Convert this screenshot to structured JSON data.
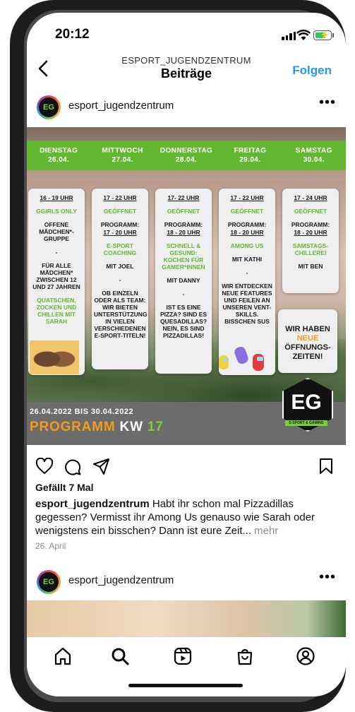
{
  "status_bar": {
    "time": "20:12"
  },
  "nav": {
    "account": "ESPORT_JUGENDZENTRUM",
    "title": "Beiträge",
    "follow_label": "Folgen"
  },
  "post": {
    "username": "esport_jugendzentrum",
    "avatar_text": "EG",
    "image": {
      "days": [
        {
          "name": "DIENSTAG",
          "date": "26.04."
        },
        {
          "name": "MITTWOCH",
          "date": "27.04."
        },
        {
          "name": "DONNERSTAG",
          "date": "28.04."
        },
        {
          "name": "FREITAG",
          "date": "29.04."
        },
        {
          "name": "SAMSTAG",
          "date": "30.04."
        }
      ],
      "cards": {
        "tue": {
          "time": "16 - 19 UHR",
          "title": "GGIRLS ONLY",
          "line1": "OFFENE MÄDCHEN*-GRUPPE",
          "line2": "FÜR ALLE MÄDCHEN* ZWISCHEN 12 UND 27 JAHREN",
          "line3": "QUATSCHEN, ZOCKEN UND CHILLEN MIT SARAH"
        },
        "wed": {
          "time": "17 - 22 UHR",
          "status": "GEÖFFNET",
          "program": "PROGRAMM:",
          "ptime": "17 - 20 UHR",
          "topic": "E-SPORT COACHING",
          "host": "MIT JOEL",
          "text": "OB EINZELN ODER ALS TEAM: WIR BIETEN UNTERSTÜTZUNG IN VIELEN VERSCHIEDENEN E-SPORT-TITELN!"
        },
        "thu": {
          "time": "17- 22 UHR",
          "status": "GEÖFFNET",
          "program": "PROGRAMM:",
          "ptime": "18 - 20 UHR",
          "topic": "SCHNELL & GESUND: KOCHEN FÜR GAMER*INNEN",
          "host": "MIT DANNY",
          "text": "IST ES EINE PIZZA? SIND ES QUESADILLAS? NEIN, ES SIND PIZZADILLAS!"
        },
        "fri": {
          "time": "17 - 22 UHR",
          "status": "GEÖFFNET",
          "program": "PROGRAMM:",
          "ptime": "18 - 20 UHR",
          "topic": "AMONG US",
          "host": "MIT KATHI",
          "text": "WIR ENTDECKEN NEUE FEATURES UND FEILEN AN UNSEREN VENT-SKILLS. BISSCHEN SUS"
        },
        "sat": {
          "time": "17 - 24 UHR",
          "status": "GEÖFFNET",
          "program": "PROGRAMM:",
          "ptime": "18 - 20 UHR",
          "topic": "SAMSTAGS-CHILLEREI",
          "host": "MIT BEN"
        },
        "hours": {
          "l1": "WIR HABEN",
          "l2": "NEUE",
          "l3": "ÖFFNUNGS-",
          "l4": "ZEITEN!"
        }
      },
      "dash": "-",
      "date_range": "26.04.2022 BIS 30.04.2022",
      "headline_a": "PROGRAMM",
      "headline_b": "KW",
      "headline_c": "17",
      "logo_letters": "EG",
      "logo_tag": "E-SPORT & GAMING"
    },
    "likes": "Gefällt 7 Mal",
    "caption_user": "esport_jugendzentrum",
    "caption_text": "Habt ihr schon mal Pizzadillas gegessen? Vermisst ihr Among Us genauso wie Sarah oder wenigstens ein bisschen? Dann ist eure Zeit...",
    "more_label": "mehr",
    "date": "26. April"
  },
  "next_post": {
    "username": "esport_jugendzentrum",
    "avatar_text": "EG"
  },
  "tabbar": {
    "items": [
      "home-icon",
      "search-icon",
      "reels-icon",
      "shop-icon",
      "profile-icon"
    ]
  },
  "colors": {
    "accent_blue": "#2196f3",
    "green": "#62b830",
    "orange": "#f39b1c"
  }
}
